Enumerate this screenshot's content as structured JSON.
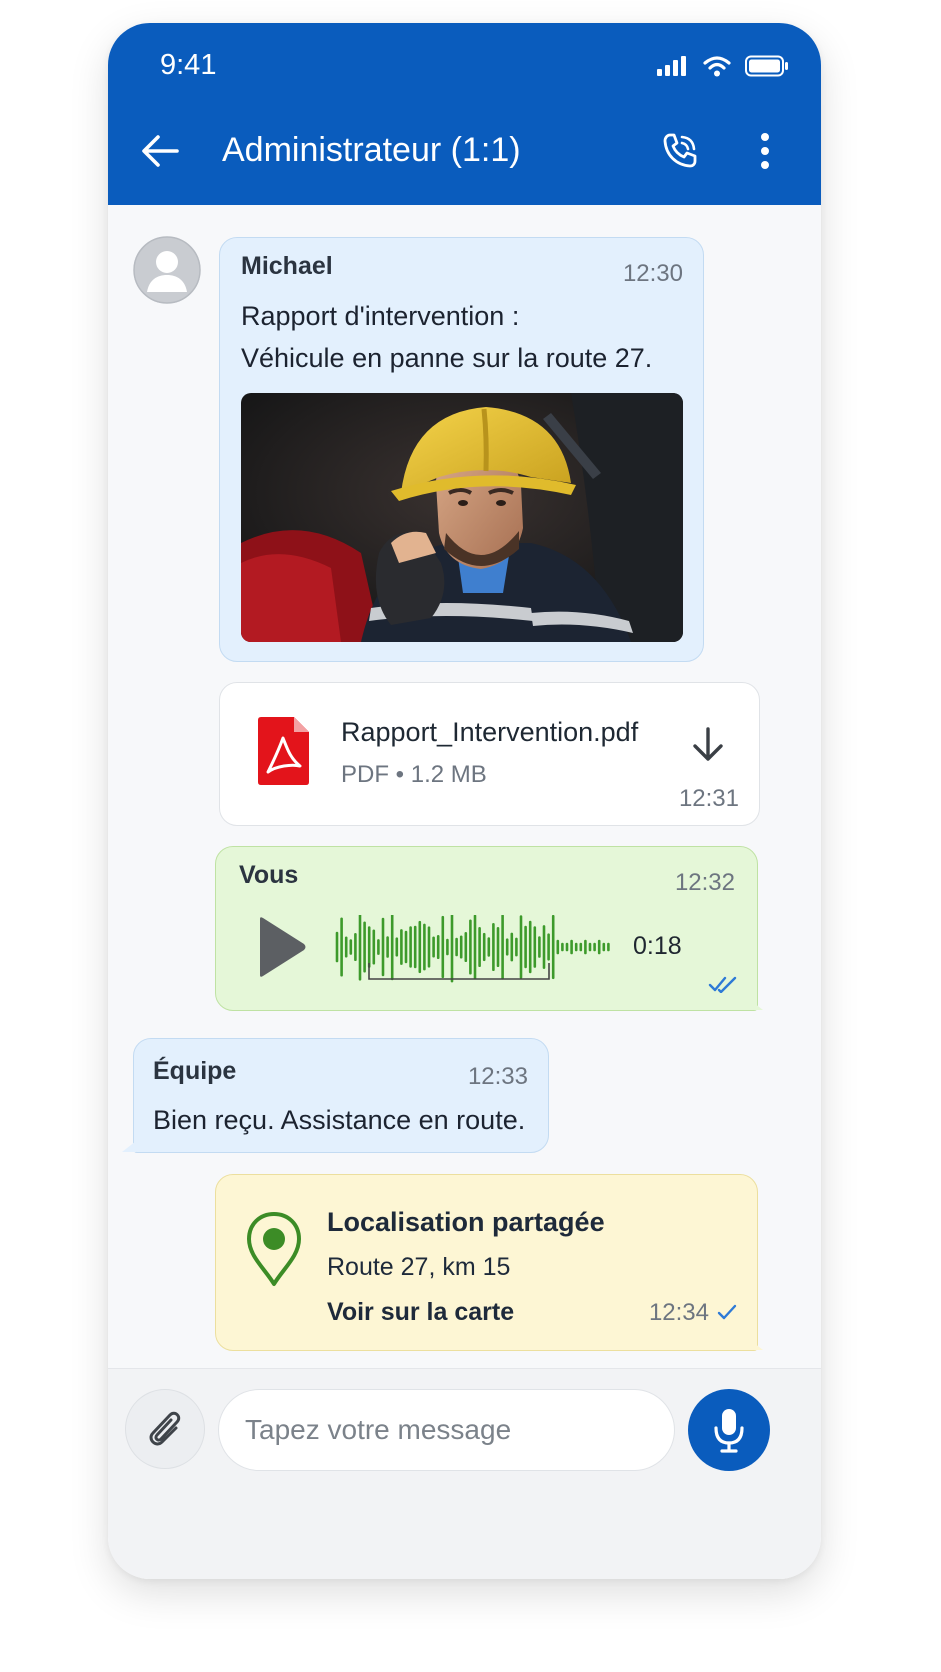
{
  "status_bar": {
    "time": "9:41"
  },
  "header": {
    "title": "Administrateur (1:1)"
  },
  "messages": [
    {
      "sender": "Michael",
      "time": "12:30",
      "lines": [
        "Rapport d'intervention :",
        "Véhicule en panne sur la route 27."
      ]
    },
    {
      "file_name": "Rapport_Intervention.pdf",
      "file_meta": "PDF • 1.2 MB",
      "time": "12:31"
    },
    {
      "sender": "Vous",
      "time": "12:32",
      "duration": "0:18",
      "status": "read"
    },
    {
      "sender": "Équipe",
      "time": "12:33",
      "text": "Bien reçu. Assistance en route."
    },
    {
      "title": "Localisation partagée",
      "address": "Route 27, km 15",
      "link": "Voir sur la carte",
      "time": "12:34",
      "status": "sent"
    }
  ],
  "composer": {
    "placeholder": "Tapez votre message"
  },
  "colors": {
    "brand": "#0a5cbd",
    "incoming": "#e3f0fd",
    "voice": "#e5f7d8",
    "location": "#fdf6d4",
    "waveform": "#3d9a2b",
    "pdf": "#e3141b",
    "pin": "#3c8c26"
  }
}
